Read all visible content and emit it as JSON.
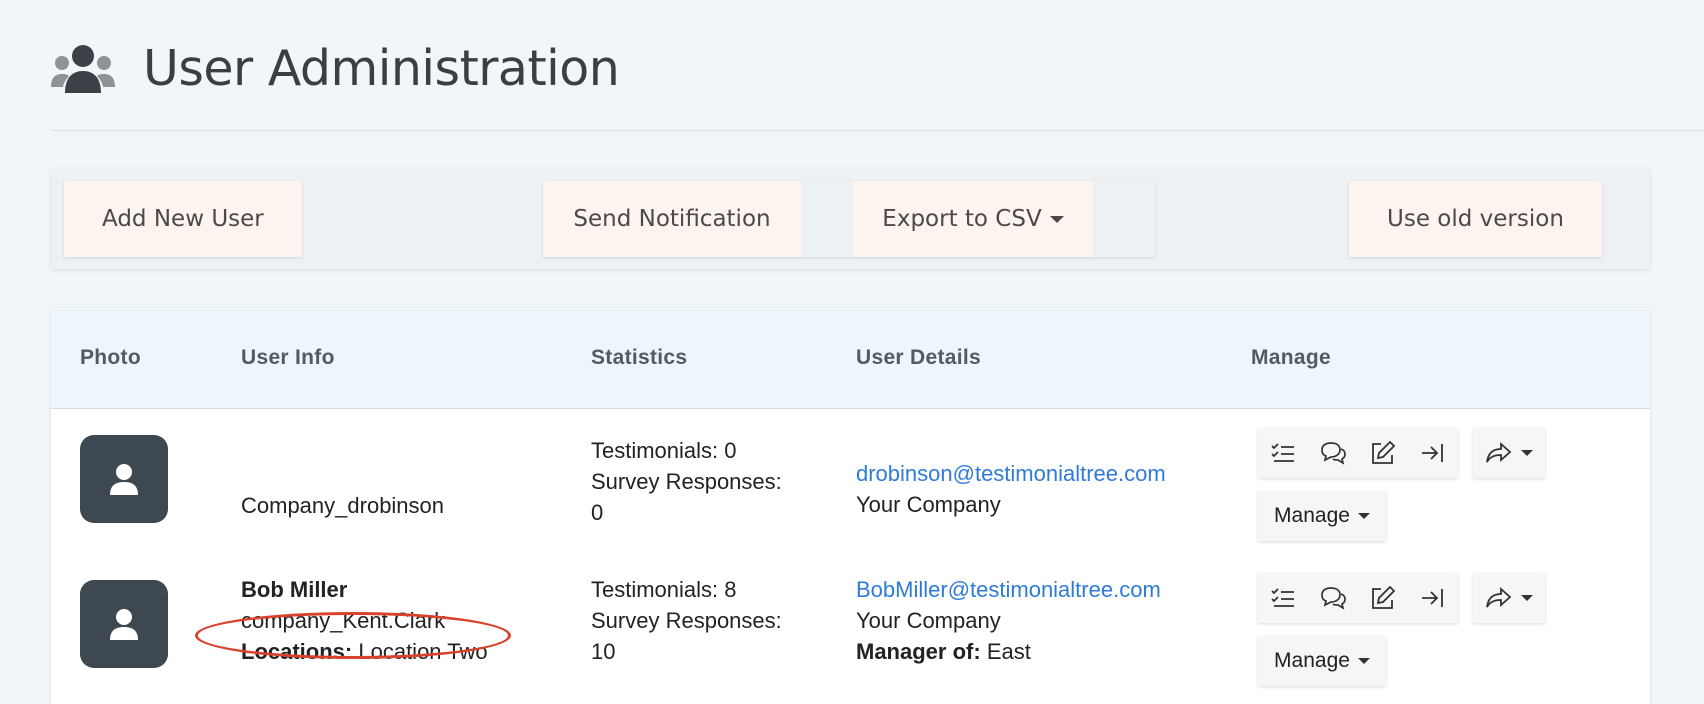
{
  "page": {
    "title": "User Administration",
    "icon": "users-icon"
  },
  "toolbar": {
    "add_user": "Add New User",
    "send_notification": "Send Notification",
    "export_csv": "Export to CSV",
    "old_version": "Use old version"
  },
  "table": {
    "headers": [
      "Photo",
      "User Info",
      "Statistics",
      "User Details",
      "Manage"
    ],
    "rows": [
      {
        "name": "",
        "username": "Company_drobinson",
        "testimonials": "Testimonials: 0",
        "survey_label": "Survey Responses:",
        "survey_value": "0",
        "email": "drobinson@testimonialtree.com",
        "company": "Your Company",
        "manage_label": "Manage"
      },
      {
        "name": "Bob Miller",
        "username": "company_Kent.Clark",
        "locations_label": "Locations:",
        "locations_value": "Location Two",
        "testimonials": "Testimonials: 8",
        "survey_label": "Survey Responses:",
        "survey_value": "10",
        "email": "BobMiller@testimonialtree.com",
        "company": "Your Company",
        "manager_label": "Manager of:",
        "manager_value": "East",
        "manage_label": "Manage"
      }
    ]
  },
  "colors": {
    "background": "#f3f6f8",
    "button_bg": "#fdf3ef",
    "link": "#2f7bd8",
    "avatar_bg": "#3d4851",
    "header_bg": "#edf6fb",
    "annotation": "#d9432c"
  },
  "action_icons": [
    "checklist-icon",
    "comments-icon",
    "edit-icon",
    "login-icon",
    "share-icon"
  ]
}
